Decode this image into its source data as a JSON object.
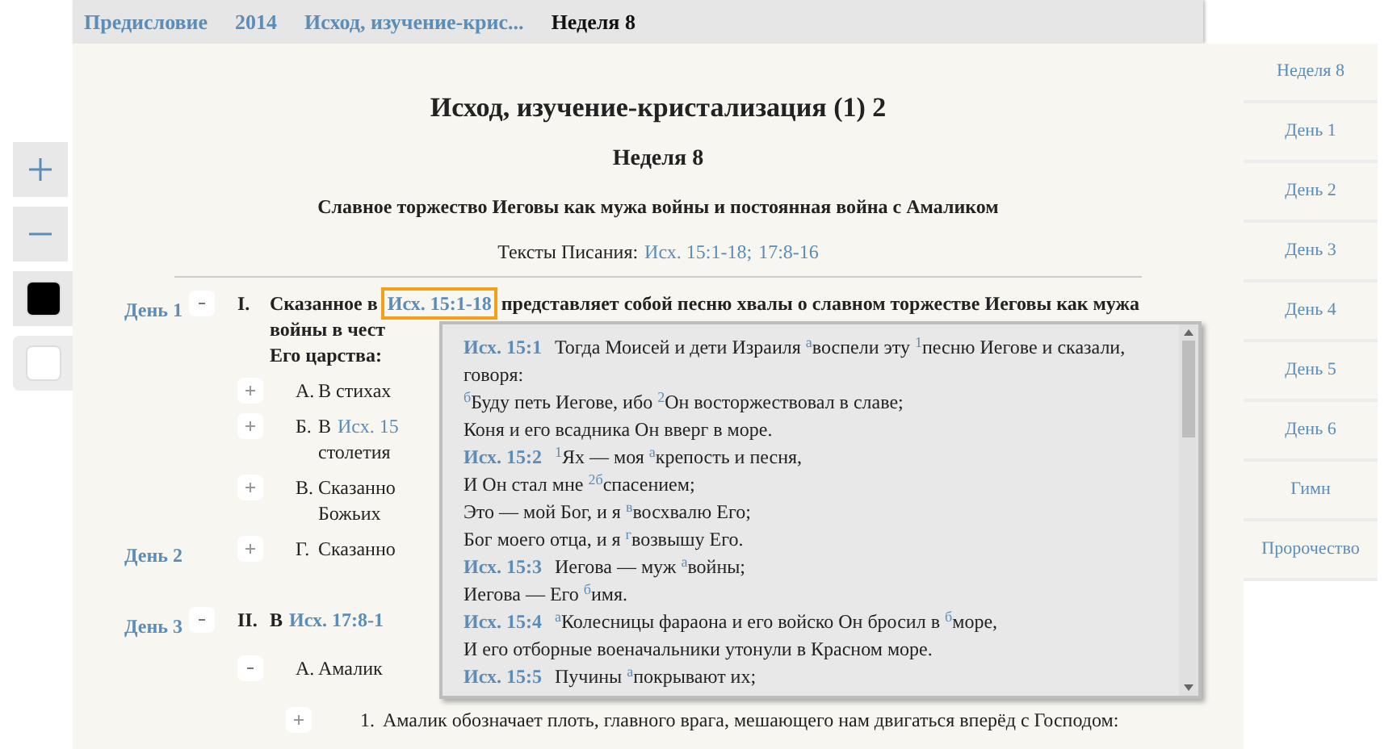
{
  "breadcrumbs": [
    {
      "label": "Предисловие",
      "selected": false
    },
    {
      "label": "2014",
      "selected": false
    },
    {
      "label": "Исход, изучение-крис...",
      "selected": false
    },
    {
      "label": "Неделя 8",
      "selected": true
    }
  ],
  "tools": [
    {
      "kind": "zoom_in"
    },
    {
      "kind": "zoom_out"
    },
    {
      "kind": "swatch",
      "color": "#000000",
      "selected": false
    },
    {
      "kind": "swatch",
      "color": "#ffffff",
      "selected": true
    }
  ],
  "title": "Исход, изучение-кристализация (1) 2",
  "week": "Неделя 8",
  "subtitle": "Славное торжество Иеговы как мужа войны и постоянная война с Амаликом",
  "scripture": {
    "label": "Тексты Писания:",
    "refs": [
      "Исх. 15:1-18",
      "17:8-16"
    ],
    "separator": ";"
  },
  "outline": [
    {
      "day": "День 1",
      "expanded": true,
      "marker": "I.",
      "bold": true,
      "lines": [
        [
          {
            "t": "Сказанное в"
          },
          {
            "ref": "Исх. 15:1-18",
            "highlighted": true
          },
          {
            "t": "представляет собой песню хвалы о славном торжестве Иеговы как мужа"
          }
        ],
        [
          {
            "t": "войны в чест"
          }
        ],
        [
          {
            "t": "Его царства:"
          }
        ]
      ],
      "children": [
        {
          "expanded": false,
          "marker": "А.",
          "bold": false,
          "lines": [
            [
              {
                "t": "В стихах"
              }
            ]
          ]
        },
        {
          "expanded": false,
          "marker": "Б.",
          "bold": false,
          "lines": [
            [
              {
                "t": "В"
              },
              {
                "ref": "Исх. 15",
                "highlighted": false
              }
            ],
            [
              {
                "t": "столетия"
              }
            ]
          ]
        },
        {
          "expanded": false,
          "marker": "В.",
          "bold": false,
          "lines": [
            [
              {
                "t": "Сказанно"
              }
            ],
            [
              {
                "t": "Божьих"
              }
            ]
          ]
        },
        {
          "day": "День 2",
          "expanded": false,
          "marker": "Г.",
          "bold": false,
          "lines": [
            [
              {
                "t": "Сказанно"
              }
            ]
          ]
        }
      ]
    },
    {
      "day": "День 3",
      "expanded": true,
      "marker": "II.",
      "bold": true,
      "lines": [
        [
          {
            "t": "В"
          },
          {
            "ref": "Исх. 17:8-1",
            "highlighted": false
          }
        ]
      ],
      "children": [
        {
          "expanded": true,
          "marker": "А.",
          "bold": false,
          "lines": [
            [
              {
                "t": "Амалик"
              }
            ]
          ],
          "children": [
            {
              "expanded": false,
              "marker": "1.",
              "bold": false,
              "lines": [
                [
                  {
                    "t": "Амалик обозначает плоть, главного врага, мешающего нам двигаться вперёд с Господом:"
                  }
                ]
              ]
            }
          ]
        }
      ]
    }
  ],
  "popup": {
    "verses": [
      {
        "ref": "Исх. 15:1",
        "lines": [
          "Тогда Моисей и дети Израиля $^{а}$воспели эту $^{1}$песню Иегове и сказали,",
          "говоря:",
          "$^{б}$Буду петь Иегове, ибо $^{2}$Он восторжествовал в славе;",
          "Коня и его всадника Он вверг в море."
        ]
      },
      {
        "ref": "Исх. 15:2",
        "lines": [
          "$^{1}$Ях — моя $^{а}$крепость и песня,",
          "И Он стал мне $^{2б}$спасением;",
          "Это — мой Бог, и я $^{в}$восхвалю Его;",
          "Бог моего отца, и я $^{г}$возвышу Его."
        ]
      },
      {
        "ref": "Исх. 15:3",
        "lines": [
          "Иегова — муж $^{а}$войны;",
          "Иегова — Его $^{б}$имя."
        ]
      },
      {
        "ref": "Исх. 15:4",
        "lines": [
          "$^{а}$Колесницы фараона и его войско Он бросил в $^{б}$море,",
          "И его отборные военачальники утонули в Красном море."
        ]
      },
      {
        "ref": "Исх. 15:5",
        "lines": [
          "Пучины $^{а}$покрывают их;"
        ]
      }
    ]
  },
  "side_tabs": [
    "Неделя 8",
    "День 1",
    "День 2",
    "День 3",
    "День 4",
    "День 5",
    "День 6",
    "Гимн",
    "Пророчество"
  ]
}
